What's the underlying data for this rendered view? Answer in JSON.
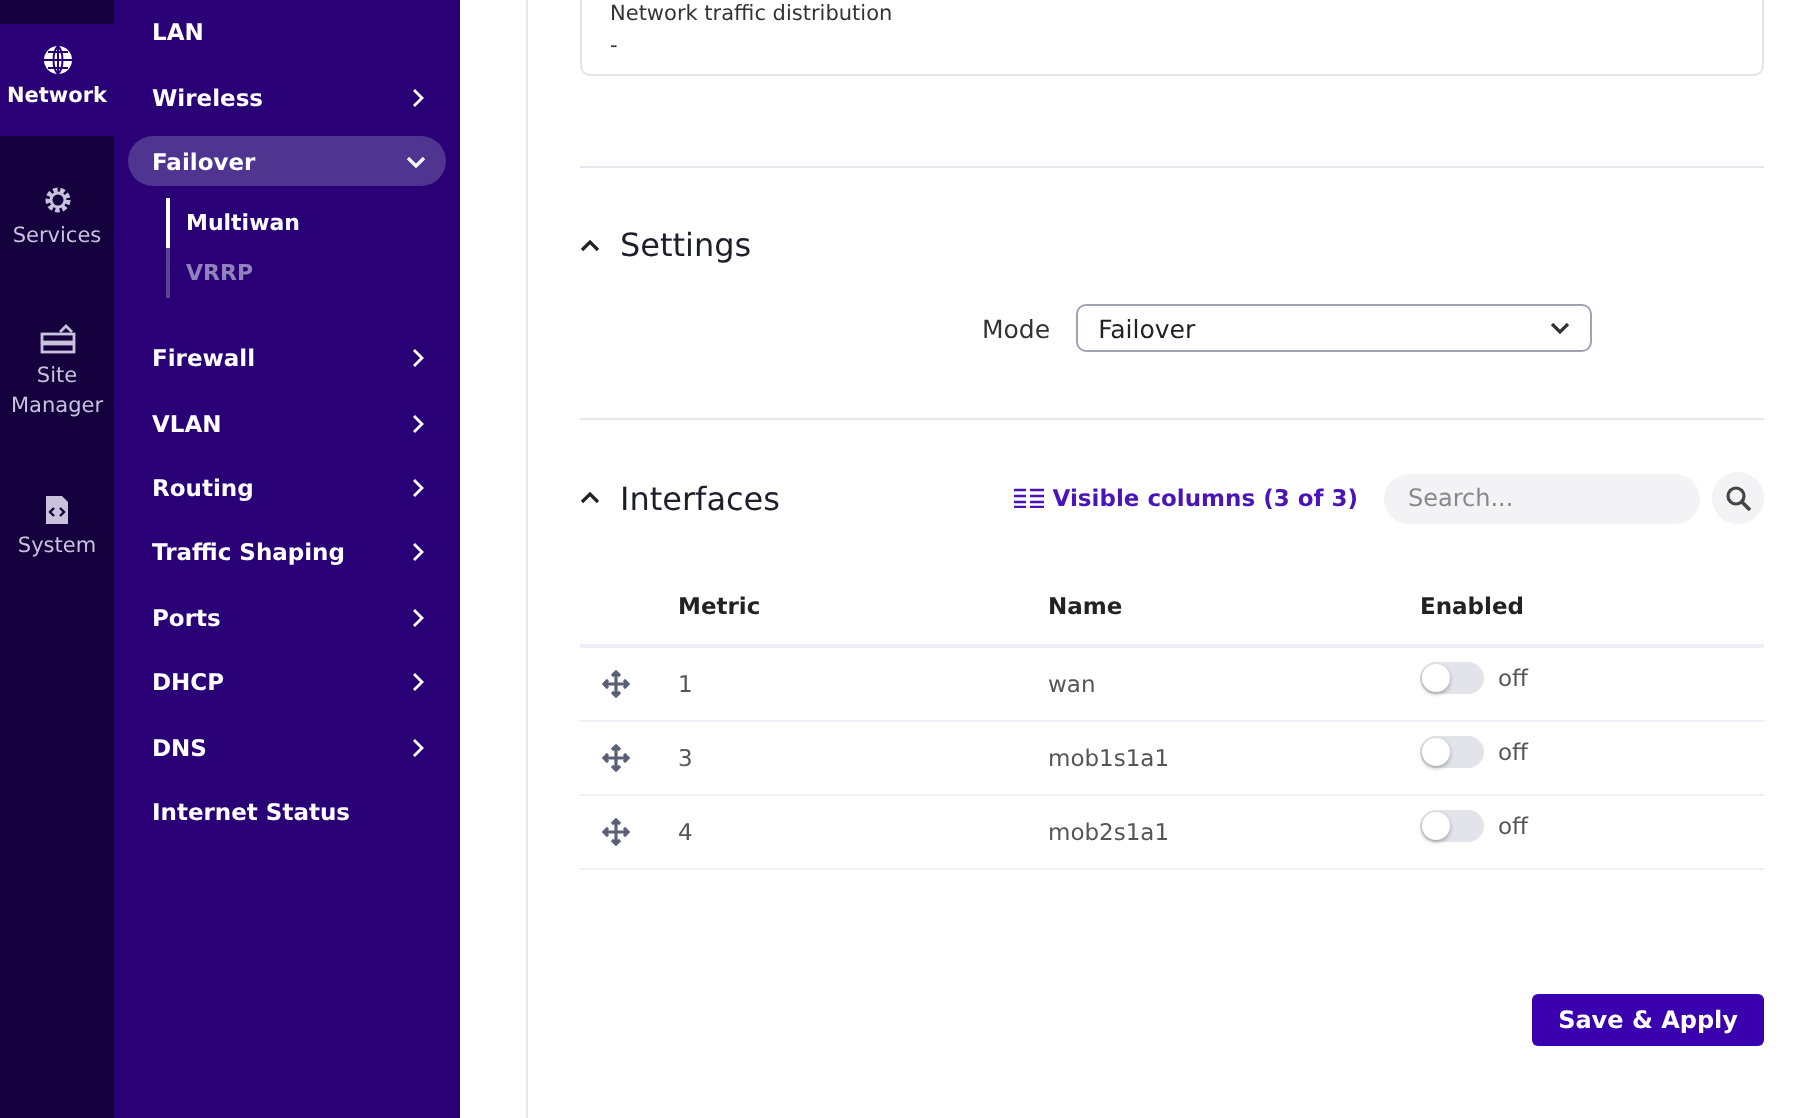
{
  "rail": [
    {
      "label": "Network",
      "kind": "globe",
      "selected": true
    },
    {
      "label": "Services",
      "kind": "gear",
      "selected": false
    },
    {
      "label": "Site Manager",
      "kind": "server",
      "selected": false
    },
    {
      "label": "System",
      "kind": "file",
      "selected": false
    }
  ],
  "nav": [
    {
      "label": "LAN",
      "kind": "link"
    },
    {
      "label": "Wireless",
      "kind": "group",
      "expanded": false
    },
    {
      "label": "Failover",
      "kind": "group",
      "expanded": true,
      "children": [
        {
          "label": "Multiwan",
          "selected": true
        },
        {
          "label": "VRRP",
          "selected": false
        }
      ]
    },
    {
      "label": "Firewall",
      "kind": "group",
      "expanded": false
    },
    {
      "label": "VLAN",
      "kind": "group",
      "expanded": false
    },
    {
      "label": "Routing",
      "kind": "group",
      "expanded": false
    },
    {
      "label": "Traffic Shaping",
      "kind": "group",
      "expanded": false
    },
    {
      "label": "Ports",
      "kind": "group",
      "expanded": false
    },
    {
      "label": "DHCP",
      "kind": "group",
      "expanded": false
    },
    {
      "label": "DNS",
      "kind": "group",
      "expanded": false
    },
    {
      "label": "Internet Status",
      "kind": "link"
    }
  ],
  "info_card": {
    "label": "Network traffic distribution",
    "value": "-"
  },
  "settings": {
    "title": "Settings",
    "expanded": true,
    "mode": {
      "label": "Mode",
      "value": "Failover"
    }
  },
  "interfaces": {
    "title": "Interfaces",
    "expanded": true,
    "visible_columns": "Visible columns (3 of 3)",
    "search": {
      "placeholder": "Search..."
    },
    "columns": [
      "Metric",
      "Name",
      "Enabled"
    ],
    "rows": [
      {
        "metric": "1",
        "name": "wan",
        "enabled": false,
        "state": "off"
      },
      {
        "metric": "3",
        "name": "mob1s1a1",
        "enabled": false,
        "state": "off"
      },
      {
        "metric": "4",
        "name": "mob2s1a1",
        "enabled": false,
        "state": "off"
      }
    ]
  },
  "save_button": "Save & Apply"
}
